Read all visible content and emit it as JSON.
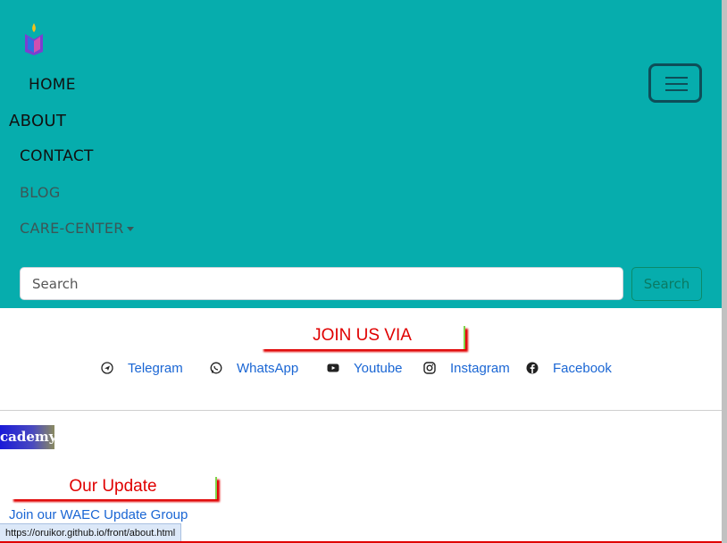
{
  "nav": {
    "items": [
      {
        "label": "HOME"
      },
      {
        "label": "ABOUT"
      },
      {
        "label": "CONTACT"
      },
      {
        "label": "BLOG"
      },
      {
        "label": "CARE-CENTER"
      }
    ],
    "toggler_icon": "hamburger-menu-icon",
    "logo_icon": "book-flame-logo"
  },
  "search": {
    "placeholder": "Search",
    "button_label": "Search"
  },
  "join": {
    "title": "JOIN US VIA",
    "socials": [
      {
        "label": "Telegram",
        "icon": "telegram-icon"
      },
      {
        "label": "WhatsApp",
        "icon": "whatsapp-icon"
      },
      {
        "label": "Youtube",
        "icon": "youtube-icon"
      },
      {
        "label": "Instagram",
        "icon": "instagram-icon"
      },
      {
        "label": "Facebook",
        "icon": "facebook-icon"
      }
    ]
  },
  "academy_badge": "cademy",
  "updates": {
    "title": "Our Update",
    "link": "Join our WAEC Update Group"
  },
  "status_url": "https://oruikor.github.io/front/about.html",
  "colors": {
    "navbar_bg": "#06adad",
    "title_red": "#e00000",
    "link_blue": "#1a66d4"
  }
}
